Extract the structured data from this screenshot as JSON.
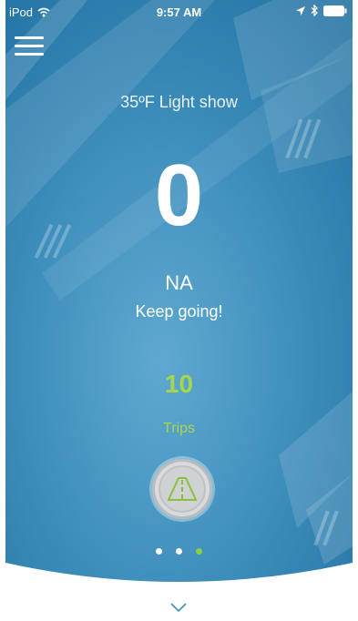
{
  "status_bar": {
    "carrier": "iPod",
    "time": "9:57 AM",
    "icons": [
      "wifi-icon",
      "location-arrow-icon",
      "bluetooth-icon",
      "battery-icon"
    ]
  },
  "menu": {
    "icon": "hamburger-menu-icon"
  },
  "weather": {
    "text": "35ºF Light show"
  },
  "score": {
    "value": "0"
  },
  "grade": {
    "value": "NA"
  },
  "message": {
    "text": "Keep going!"
  },
  "trips": {
    "count": "10",
    "label": "Trips"
  },
  "road_button": {
    "icon": "road-icon"
  },
  "pager": {
    "total": 3,
    "active_index": 2
  },
  "colors": {
    "accent_green": "#a8d64b",
    "background_blue": "#2f7fae"
  }
}
